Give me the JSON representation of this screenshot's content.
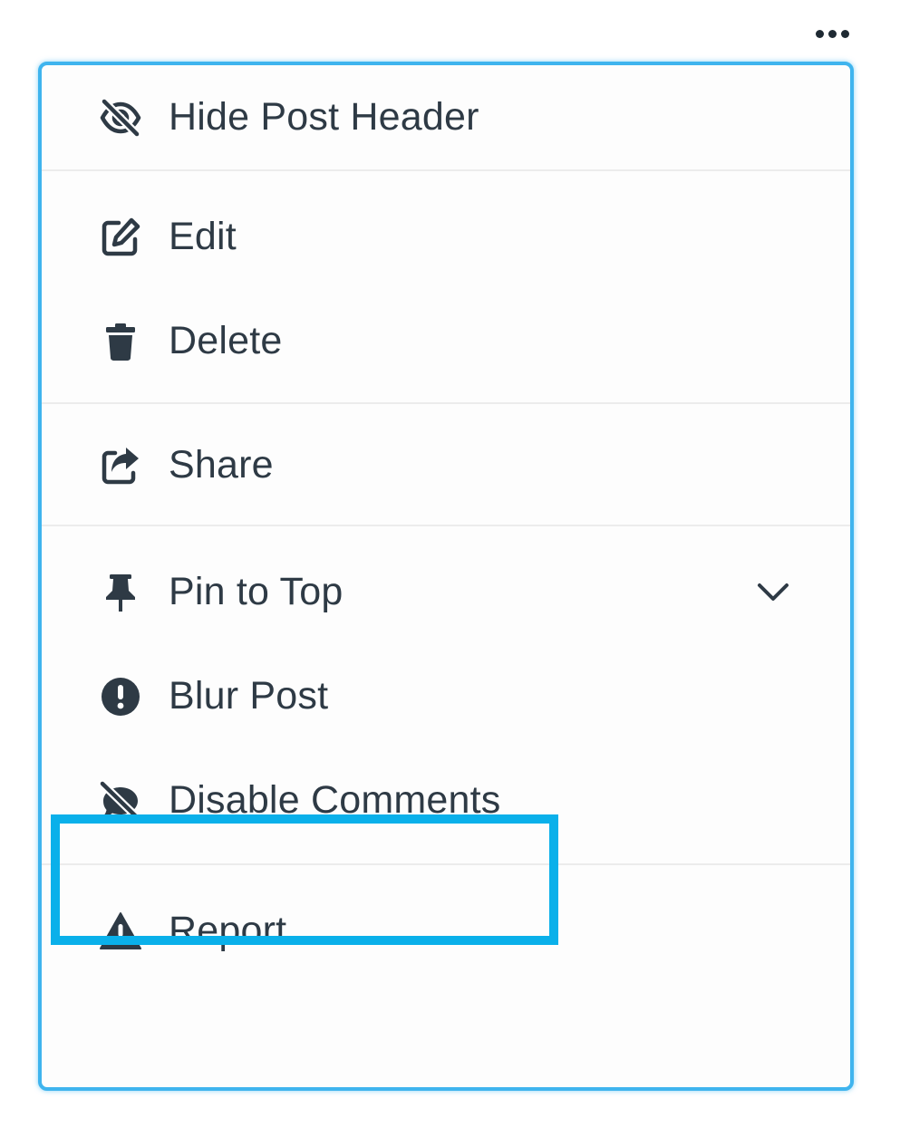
{
  "more_button": {
    "icon": "more-horizontal-icon"
  },
  "menu": {
    "groups": [
      {
        "items": [
          {
            "label": "Hide Post Header",
            "icon": "eye-slash-icon"
          }
        ]
      },
      {
        "items": [
          {
            "label": "Edit",
            "icon": "edit-icon"
          },
          {
            "label": "Delete",
            "icon": "trash-icon"
          }
        ]
      },
      {
        "items": [
          {
            "label": "Share",
            "icon": "share-icon"
          }
        ]
      },
      {
        "items": [
          {
            "label": "Pin to Top",
            "icon": "pin-icon",
            "trailing_icon": "chevron-down-icon"
          },
          {
            "label": "Blur Post",
            "icon": "exclamation-circle-icon"
          },
          {
            "label": "Disable Comments",
            "icon": "comment-slash-icon",
            "highlighted": true
          }
        ]
      },
      {
        "items": [
          {
            "label": "Report",
            "icon": "warning-triangle-icon"
          }
        ]
      }
    ]
  },
  "colors": {
    "menu_border": "#3fb4ee",
    "highlight": "#0ab0ea",
    "text": "#2e3a45",
    "icon": "#2e3a45"
  }
}
